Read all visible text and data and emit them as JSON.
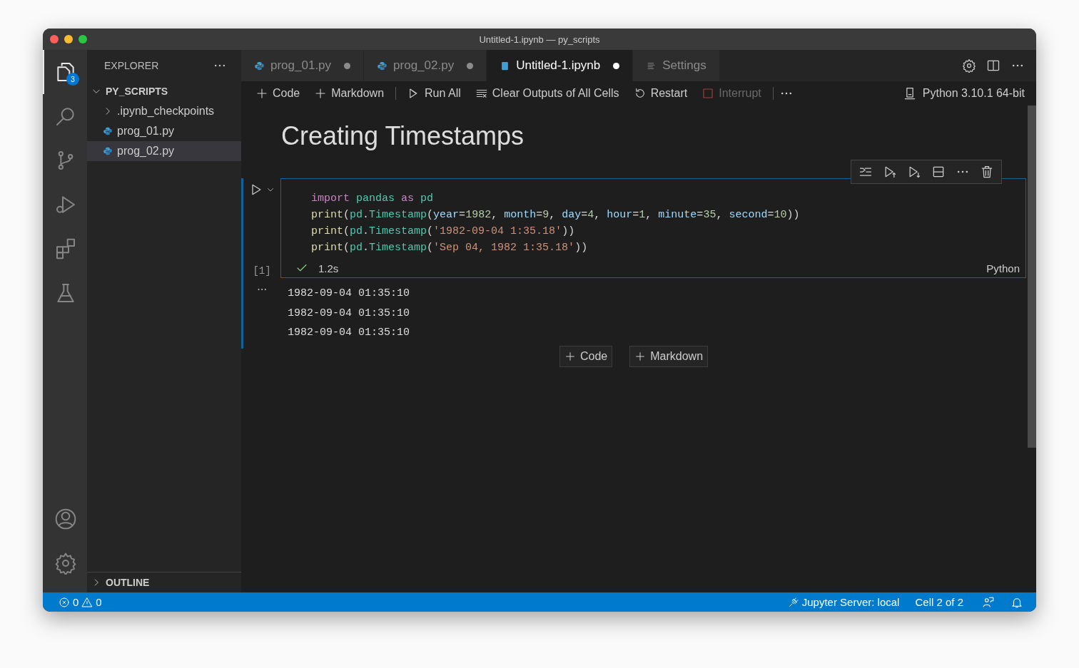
{
  "window": {
    "title": "Untitled-1.ipynb — py_scripts"
  },
  "activity_bar": {
    "items": [
      {
        "kind": "explorer",
        "selected": true,
        "badge": "3"
      },
      {
        "kind": "search",
        "selected": false
      },
      {
        "kind": "source-control",
        "selected": false
      },
      {
        "kind": "run-debug",
        "selected": false
      },
      {
        "kind": "extensions",
        "selected": false
      },
      {
        "kind": "testing",
        "selected": false
      }
    ],
    "bottom_items": [
      {
        "kind": "account"
      },
      {
        "kind": "settings"
      }
    ]
  },
  "sidebar": {
    "title": "EXPLORER",
    "folder": {
      "name": "PY_SCRIPTS",
      "expanded": true,
      "children": [
        {
          "kind": "folder",
          "name": ".ipynb_checkpoints",
          "expanded": false,
          "selected": false
        },
        {
          "kind": "python",
          "name": "prog_01.py",
          "selected": false
        },
        {
          "kind": "python",
          "name": "prog_02.py",
          "selected": true
        }
      ]
    },
    "outline": {
      "label": "OUTLINE",
      "expanded": false
    }
  },
  "tabs": [
    {
      "kind": "python",
      "label": "prog_01.py",
      "selected": false,
      "modified": true
    },
    {
      "kind": "python",
      "label": "prog_02.py",
      "selected": false,
      "modified": true
    },
    {
      "kind": "notebook",
      "label": "Untitled-1.ipynb",
      "selected": true,
      "modified": true
    },
    {
      "kind": "settings",
      "label": "Settings",
      "selected": false,
      "modified": false
    }
  ],
  "toolbar": {
    "items": [
      {
        "kind": "add",
        "label": "Code",
        "disabled": false
      },
      {
        "kind": "add",
        "label": "Markdown",
        "disabled": false
      },
      {
        "kind": "separator"
      },
      {
        "kind": "run",
        "label": "Run All",
        "disabled": false
      },
      {
        "kind": "clear",
        "label": "Clear Outputs of All Cells",
        "disabled": false
      },
      {
        "kind": "restart",
        "label": "Restart",
        "disabled": false
      },
      {
        "kind": "interrupt",
        "label": "Interrupt",
        "disabled": true
      },
      {
        "kind": "separator"
      },
      {
        "kind": "more"
      }
    ],
    "kernel": "Python 3.10.1 64-bit"
  },
  "notebook": {
    "heading": "Creating Timestamps",
    "cell": {
      "execution_count": "[1]",
      "status": "1.2s",
      "language": "Python",
      "lines": [
        [
          {
            "kind": "keyword",
            "text": "import "
          },
          {
            "kind": "module",
            "text": "pandas "
          },
          {
            "kind": "keyword",
            "text": "as "
          },
          {
            "kind": "module",
            "text": "pd"
          }
        ],
        [
          {
            "kind": "func",
            "text": "print"
          },
          {
            "kind": "punct",
            "text": "("
          },
          {
            "kind": "module",
            "text": "pd"
          },
          {
            "kind": "punct",
            "text": "."
          },
          {
            "kind": "module",
            "text": "Timestamp"
          },
          {
            "kind": "punct",
            "text": "("
          },
          {
            "kind": "param",
            "text": "year"
          },
          {
            "kind": "punct",
            "text": "="
          },
          {
            "kind": "number",
            "text": "1982"
          },
          {
            "kind": "punct",
            "text": ", "
          },
          {
            "kind": "param",
            "text": "month"
          },
          {
            "kind": "punct",
            "text": "="
          },
          {
            "kind": "number",
            "text": "9"
          },
          {
            "kind": "punct",
            "text": ", "
          },
          {
            "kind": "param",
            "text": "day"
          },
          {
            "kind": "punct",
            "text": "="
          },
          {
            "kind": "number",
            "text": "4"
          },
          {
            "kind": "punct",
            "text": ", "
          },
          {
            "kind": "param",
            "text": "hour"
          },
          {
            "kind": "punct",
            "text": "="
          },
          {
            "kind": "number",
            "text": "1"
          },
          {
            "kind": "punct",
            "text": ", "
          },
          {
            "kind": "param",
            "text": "minute"
          },
          {
            "kind": "punct",
            "text": "="
          },
          {
            "kind": "number",
            "text": "35"
          },
          {
            "kind": "punct",
            "text": ", "
          },
          {
            "kind": "param",
            "text": "second"
          },
          {
            "kind": "punct",
            "text": "="
          },
          {
            "kind": "number",
            "text": "10"
          },
          {
            "kind": "punct",
            "text": "))"
          }
        ],
        [
          {
            "kind": "func",
            "text": "print"
          },
          {
            "kind": "punct",
            "text": "("
          },
          {
            "kind": "module",
            "text": "pd"
          },
          {
            "kind": "punct",
            "text": "."
          },
          {
            "kind": "module",
            "text": "Timestamp"
          },
          {
            "kind": "punct",
            "text": "("
          },
          {
            "kind": "string",
            "text": "'1982-09-04 1:35.18'"
          },
          {
            "kind": "punct",
            "text": "))"
          }
        ],
        [
          {
            "kind": "func",
            "text": "print"
          },
          {
            "kind": "punct",
            "text": "("
          },
          {
            "kind": "module",
            "text": "pd"
          },
          {
            "kind": "punct",
            "text": "."
          },
          {
            "kind": "module",
            "text": "Timestamp"
          },
          {
            "kind": "punct",
            "text": "("
          },
          {
            "kind": "string",
            "text": "'Sep 04, 1982 1:35.18'"
          },
          {
            "kind": "punct",
            "text": "))"
          }
        ]
      ],
      "outputs": [
        "1982-09-04 01:35:10",
        "1982-09-04 01:35:10",
        "1982-09-04 01:35:10"
      ]
    },
    "add_buttons": [
      {
        "label": "Code"
      },
      {
        "label": "Markdown"
      }
    ]
  },
  "status_bar": {
    "errors": "0",
    "warnings": "0",
    "jupyter": "Jupyter Server: local",
    "cell_position": "Cell 2 of 2"
  }
}
